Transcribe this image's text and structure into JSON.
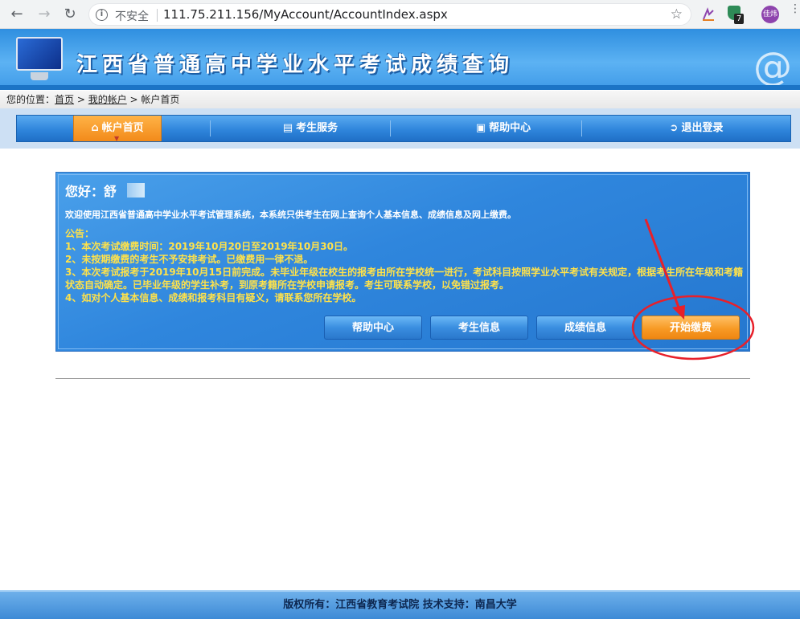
{
  "browser": {
    "insecure_label": "不安全",
    "url": "111.75.211.156/MyAccount/AccountIndex.aspx",
    "ext_badge": "7",
    "avatar_text": "佳炜"
  },
  "header": {
    "title": "江西省普通高中学业水平考试成绩查询"
  },
  "breadcrumb": {
    "prefix": "您的位置：",
    "home": "首页",
    "sep1": " > ",
    "account": "我的帐户",
    "sep2": " > ",
    "current": "帐户首页"
  },
  "nav": {
    "items": [
      {
        "label": "帐户首页",
        "icon": "home-icon"
      },
      {
        "label": "考生服务",
        "icon": "service-icon"
      },
      {
        "label": "帮助中心",
        "icon": "help-icon"
      },
      {
        "label": "退出登录",
        "icon": "logout-icon"
      }
    ]
  },
  "panel": {
    "greeting": "您好：舒",
    "welcome": "欢迎使用江西省普通高中学业水平考试管理系统，本系统只供考生在网上查询个人基本信息、成绩信息及网上缴费。",
    "notice_title": "公告：",
    "notices": [
      "1、本次考试缴费时间：2019年10月20日至2019年10月30日。",
      "2、未按期缴费的考生不予安排考试。已缴费用一律不退。",
      "3、本次考试报考于2019年10月15日前完成。未毕业年级在校生的报考由所在学校统一进行，考试科目按照学业水平考试有关规定，根据考生所在年级和考籍状态自动确定。已毕业年级的学生补考，到原考籍所在学校申请报考。考生可联系学校，以免错过报考。",
      "4、如对个人基本信息、成绩和报考科目有疑义，请联系您所在学校。"
    ],
    "buttons": {
      "help": "帮助中心",
      "info": "考生信息",
      "score": "成绩信息",
      "pay": "开始缴费"
    }
  },
  "footer": {
    "text": "版权所有：江西省教育考试院 技术支持：南昌大学"
  },
  "colors": {
    "annotation": "#e8202a",
    "accent_orange": "#f79a25",
    "accent_blue": "#2f86dc"
  }
}
